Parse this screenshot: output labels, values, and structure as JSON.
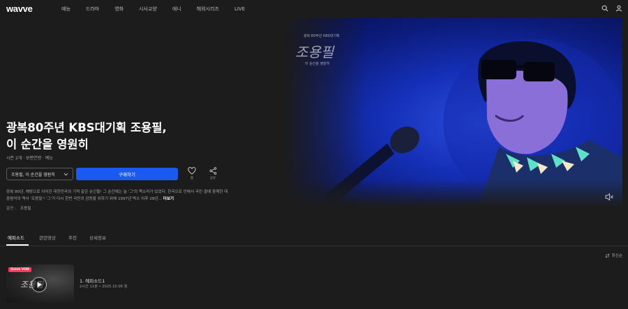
{
  "header": {
    "logo": "wavve",
    "nav": [
      "예능",
      "드라마",
      "영화",
      "시사교양",
      "애니",
      "해외시리즈",
      "LIVE"
    ]
  },
  "hero": {
    "show_logo_small": "광복 80주년 KBS대기획",
    "show_logo_big": "조용필",
    "show_logo_sub": "이 순간을 영원히",
    "title": "광복80주년 KBS대기획 조용필, 이 순간을 영원히",
    "meta": "시즌 2개 · 보편연령 · 예능",
    "season_select": "조용필, 이 순간을 영원히",
    "play_label": "구매하기",
    "like_label": "찜",
    "share_label": "공유",
    "description": "광복 80년, 해방으로 이어진 대한민국의 기적 같은 순간들! 그 순간에는 늘 '그'의 목소리가 있었다. 한국으로 인해서 국민 곁에 함께한 대중음악의 역사 '조용필'! '그'가 다시 한번 국민의 감동을 위하기 위해 1997년 박스 이후 28년...",
    "more_label": "더보기",
    "cast_label": "출연 :",
    "cast_value": "조용필"
  },
  "tabs": [
    "에피소드",
    "관련영상",
    "추천",
    "상세정보"
  ],
  "sort_label": "최신순",
  "episode": {
    "badge": "Quick VOD",
    "thumb_title": "조용필",
    "title": "1. 에피소드1",
    "meta": "2시간 11분  •  2025.10.06 월"
  },
  "colors": {
    "accent": "#1a5af0",
    "background": "#1c1c1c",
    "badge": "#ff3a5c"
  }
}
